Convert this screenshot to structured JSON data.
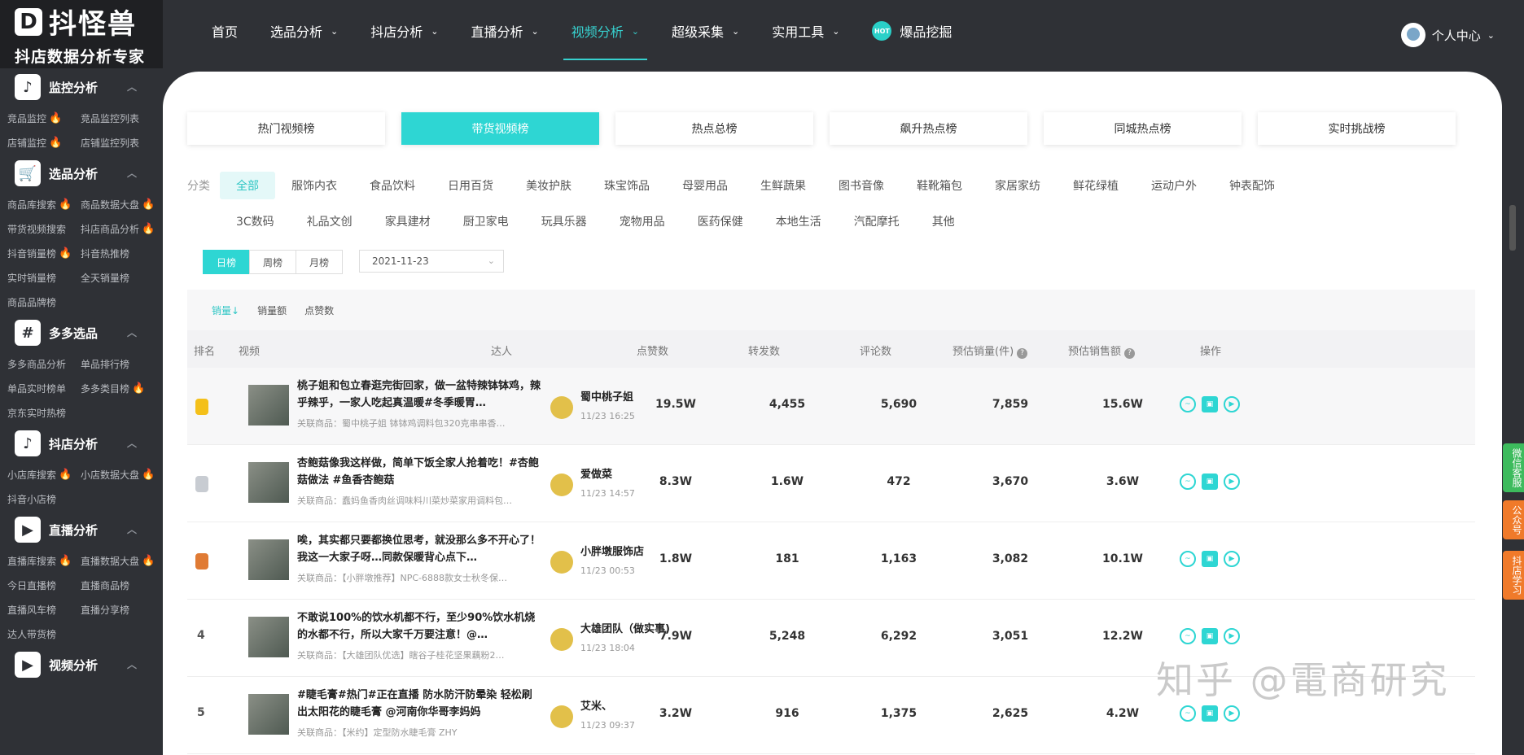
{
  "brand": {
    "mark": "D",
    "name": "抖怪兽",
    "subtitle": "抖店数据分析专家"
  },
  "sidebar": [
    {
      "title": "监控分析",
      "icon": "tiktok-icon",
      "items": [
        {
          "label": "竞品监控",
          "fire": true
        },
        {
          "label": "竞品监控列表",
          "fire": false
        },
        {
          "label": "店铺监控",
          "fire": true
        },
        {
          "label": "店铺监控列表",
          "fire": false
        }
      ]
    },
    {
      "title": "选品分析",
      "icon": "cart-icon",
      "items": [
        {
          "label": "商品库搜索",
          "fire": true
        },
        {
          "label": "商品数据大盘",
          "fire": true
        },
        {
          "label": "带货视频搜索",
          "fire": false
        },
        {
          "label": "抖店商品分析",
          "fire": true
        },
        {
          "label": "抖音销量榜",
          "fire": true
        },
        {
          "label": "抖音热推榜",
          "fire": false
        },
        {
          "label": "实时销量榜",
          "fire": false
        },
        {
          "label": "全天销量榜",
          "fire": false
        },
        {
          "label": "商品品牌榜",
          "fire": false
        }
      ]
    },
    {
      "title": "多多选品",
      "icon": "hash-icon",
      "items": [
        {
          "label": "多多商品分析",
          "fire": false
        },
        {
          "label": "单品排行榜",
          "fire": false
        },
        {
          "label": "单品实时榜单",
          "fire": false
        },
        {
          "label": "多多类目榜",
          "fire": true
        },
        {
          "label": "京东实时热榜",
          "fire": false
        }
      ]
    },
    {
      "title": "抖店分析",
      "icon": "tiktok-icon",
      "items": [
        {
          "label": "小店库搜索",
          "fire": true
        },
        {
          "label": "小店数据大盘",
          "fire": true
        },
        {
          "label": "抖音小店榜",
          "fire": false
        }
      ]
    },
    {
      "title": "直播分析",
      "icon": "live-icon",
      "items": [
        {
          "label": "直播库搜索",
          "fire": true
        },
        {
          "label": "直播数据大盘",
          "fire": true
        },
        {
          "label": "今日直播榜",
          "fire": false
        },
        {
          "label": "直播商品榜",
          "fire": false
        },
        {
          "label": "直播风车榜",
          "fire": false
        },
        {
          "label": "直播分享榜",
          "fire": false
        },
        {
          "label": "达人带货榜",
          "fire": false
        }
      ]
    },
    {
      "title": "视频分析",
      "icon": "video-icon",
      "items": []
    }
  ],
  "nav": [
    {
      "label": "首页",
      "dropdown": false,
      "active": false
    },
    {
      "label": "选品分析",
      "dropdown": true,
      "active": false
    },
    {
      "label": "抖店分析",
      "dropdown": true,
      "active": false
    },
    {
      "label": "直播分析",
      "dropdown": true,
      "active": false
    },
    {
      "label": "视频分析",
      "dropdown": true,
      "active": true
    },
    {
      "label": "超级采集",
      "dropdown": true,
      "active": false
    },
    {
      "label": "实用工具",
      "dropdown": true,
      "active": false
    },
    {
      "label": "爆品挖掘",
      "dropdown": false,
      "active": false,
      "badge": "HOT"
    }
  ],
  "user": {
    "label": "个人中心"
  },
  "tabs": [
    {
      "label": "热门视频榜",
      "active": false
    },
    {
      "label": "带货视频榜",
      "active": true
    },
    {
      "label": "热点总榜",
      "active": false
    },
    {
      "label": "飙升热点榜",
      "active": false
    },
    {
      "label": "同城热点榜",
      "active": false
    },
    {
      "label": "实时挑战榜",
      "active": false
    }
  ],
  "categories": {
    "label": "分类",
    "row1": [
      "全部",
      "服饰内衣",
      "食品饮料",
      "日用百货",
      "美妆护肤",
      "珠宝饰品",
      "母婴用品",
      "生鲜蔬果",
      "图书音像",
      "鞋靴箱包",
      "家居家纺",
      "鲜花绿植",
      "运动户外",
      "钟表配饰"
    ],
    "row2": [
      "3C数码",
      "礼品文创",
      "家具建材",
      "厨卫家电",
      "玩具乐器",
      "宠物用品",
      "医药保健",
      "本地生活",
      "汽配摩托",
      "其他"
    ],
    "active": "全部"
  },
  "period": {
    "options": [
      "日榜",
      "周榜",
      "月榜"
    ],
    "active": "日榜",
    "date": "2021-11-23"
  },
  "sort": {
    "options": [
      "销量",
      "销量额",
      "点赞数"
    ],
    "active": "销量",
    "active_arrow": "↓"
  },
  "table": {
    "headers": {
      "rank": "排名",
      "video": "视频",
      "author": "达人",
      "likes": "点赞数",
      "shares": "转发数",
      "comments": "评论数",
      "est_sales": "预估销量(件)",
      "est_revenue": "预估销售额",
      "ops": "操作"
    },
    "rows": [
      {
        "rank": "1",
        "medal": "gold",
        "title": "桃子姐和包立春逛完街回家，做一盆特辣钵钵鸡，辣乎辣乎，一家人吃起真温暖#冬季暖胃…",
        "product": "关联商品：蜀中桃子姐 钵钵鸡调料包320克串串香…",
        "author": "蜀中桃子姐",
        "time": "11/23 16:25",
        "likes": "19.5W",
        "shares": "4,455",
        "comments": "5,690",
        "sales": "7,859",
        "revenue": "15.6W"
      },
      {
        "rank": "2",
        "medal": "silver",
        "title": "杏鲍菇像我这样做，简单下饭全家人抢着吃！#杏鲍菇做法 #鱼香杏鲍菇",
        "product": "关联商品：蠢妈鱼香肉丝调味料川菜炒菜家用调料包…",
        "author": "爱做菜",
        "time": "11/23 14:57",
        "likes": "8.3W",
        "shares": "1.6W",
        "comments": "472",
        "sales": "3,670",
        "revenue": "3.6W"
      },
      {
        "rank": "3",
        "medal": "bronze",
        "title": "唉，其实都只要都换位思考，就没那么多不开心了！我这一大家子呀…同款保暖背心点下…",
        "product": "关联商品：【小胖墩推荐】NPC-6888款女士秋冬保…",
        "author": "小胖墩服饰店",
        "time": "11/23 00:53",
        "likes": "1.8W",
        "shares": "181",
        "comments": "1,163",
        "sales": "3,082",
        "revenue": "10.1W"
      },
      {
        "rank": "4",
        "medal": "",
        "title": "不敢说100%的饮水机都不行，至少90%饮水机烧的水都不行，所以大家千万要注意！@…",
        "product": "关联商品：【大雄团队优选】瞎谷子桂花坚果藕粉2…",
        "author": "大雄团队（做实事)",
        "time": "11/23 18:04",
        "likes": "7.9W",
        "shares": "5,248",
        "comments": "6,292",
        "sales": "3,051",
        "revenue": "12.2W"
      },
      {
        "rank": "5",
        "medal": "",
        "title": "#睫毛膏#热门#正在直播 防水防汗防晕染 轻松刷出太阳花的睫毛膏 @河南你华哥李妈妈",
        "product": "关联商品：【米约】定型防水睫毛膏 ZHY",
        "author": "艾米、",
        "time": "11/23 09:37",
        "likes": "3.2W",
        "shares": "916",
        "comments": "1,375",
        "sales": "2,625",
        "revenue": "4.2W"
      }
    ]
  },
  "side_tabs": [
    "微信客服",
    "公众号",
    "抖店学习"
  ],
  "watermark": "知乎 @電商研究"
}
